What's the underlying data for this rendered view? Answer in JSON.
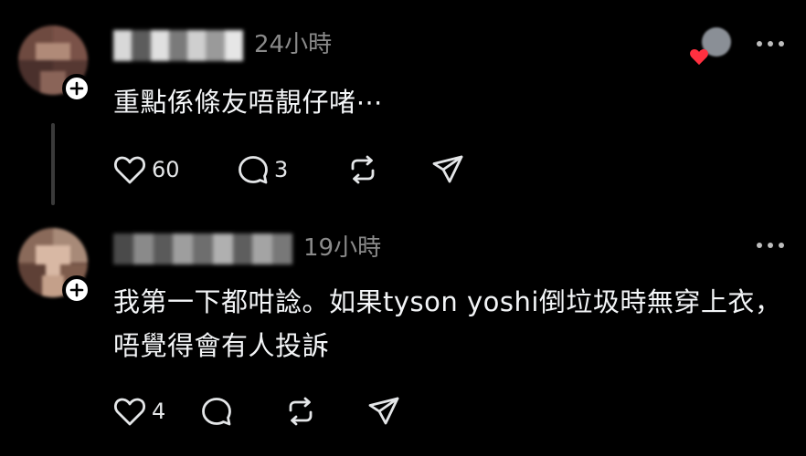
{
  "posts": [
    {
      "username_redacted": true,
      "timestamp": "24小時",
      "text": "重點係條友唔靚仔啫⋯",
      "likes": "60",
      "replies": "3",
      "has_liker_avatar": true,
      "icons": {
        "like": "heart-outline-icon",
        "reply": "speech-bubble-icon",
        "repost": "repost-arrows-icon",
        "share": "paper-plane-icon",
        "more": "more-dots-icon",
        "follow": "plus-icon"
      }
    },
    {
      "username_redacted": true,
      "timestamp": "19小時",
      "text": "我第一下都咁諗。如果tyson yoshi倒垃圾時無穿上衣，唔覺得會有人投訴",
      "likes": "4",
      "replies": "",
      "icons": {
        "like": "heart-outline-icon",
        "reply": "speech-bubble-icon",
        "repost": "repost-arrows-icon",
        "share": "paper-plane-icon",
        "more": "more-dots-icon",
        "follow": "plus-icon"
      }
    }
  ],
  "colors": {
    "background": "#000000",
    "text": "#f3f5f7",
    "muted": "#8a8a8a",
    "heart_badge": "#ff3040"
  }
}
